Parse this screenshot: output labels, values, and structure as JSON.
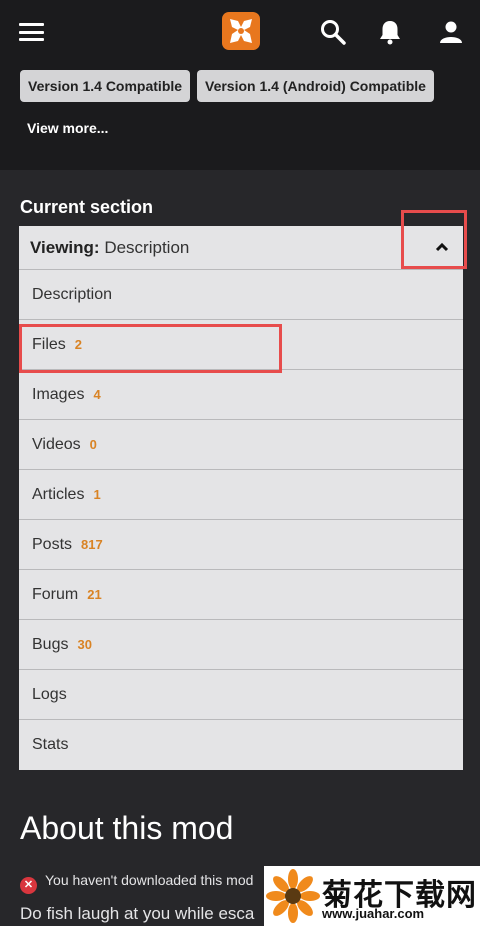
{
  "header": {
    "menu_icon": "hamburger-menu-icon",
    "logo_icon": "nexus-logo-icon",
    "search_icon": "search-icon",
    "notifications_icon": "bell-icon",
    "profile_icon": "user-icon",
    "accent_color": "#e8771e"
  },
  "tags": {
    "items": [
      "Version 1.4 Compatible",
      "Version 1.4 (Android) Compatible"
    ],
    "view_more": "View more..."
  },
  "current_section": {
    "title": "Current section",
    "viewing_label": "Viewing:",
    "viewing_value": "Description",
    "caret_icon": "chevron-up-icon",
    "items": [
      {
        "label": "Description",
        "count": ""
      },
      {
        "label": "Files",
        "count": "2"
      },
      {
        "label": "Images",
        "count": "4"
      },
      {
        "label": "Videos",
        "count": "0"
      },
      {
        "label": "Articles",
        "count": "1"
      },
      {
        "label": "Posts",
        "count": "817"
      },
      {
        "label": "Forum",
        "count": "21"
      },
      {
        "label": "Bugs",
        "count": "30"
      },
      {
        "label": "Logs",
        "count": ""
      },
      {
        "label": "Stats",
        "count": ""
      }
    ]
  },
  "about": {
    "title": "About this mod",
    "warning_icon": "error-x-icon",
    "warning": "You haven't downloaded this mod",
    "description": "Do fish laugh at you while esca"
  },
  "watermark": {
    "title": "菊花下载网",
    "url": "www.juahar.com",
    "flower_icon": "flower-icon"
  },
  "highlight_color": "#e74c4c"
}
